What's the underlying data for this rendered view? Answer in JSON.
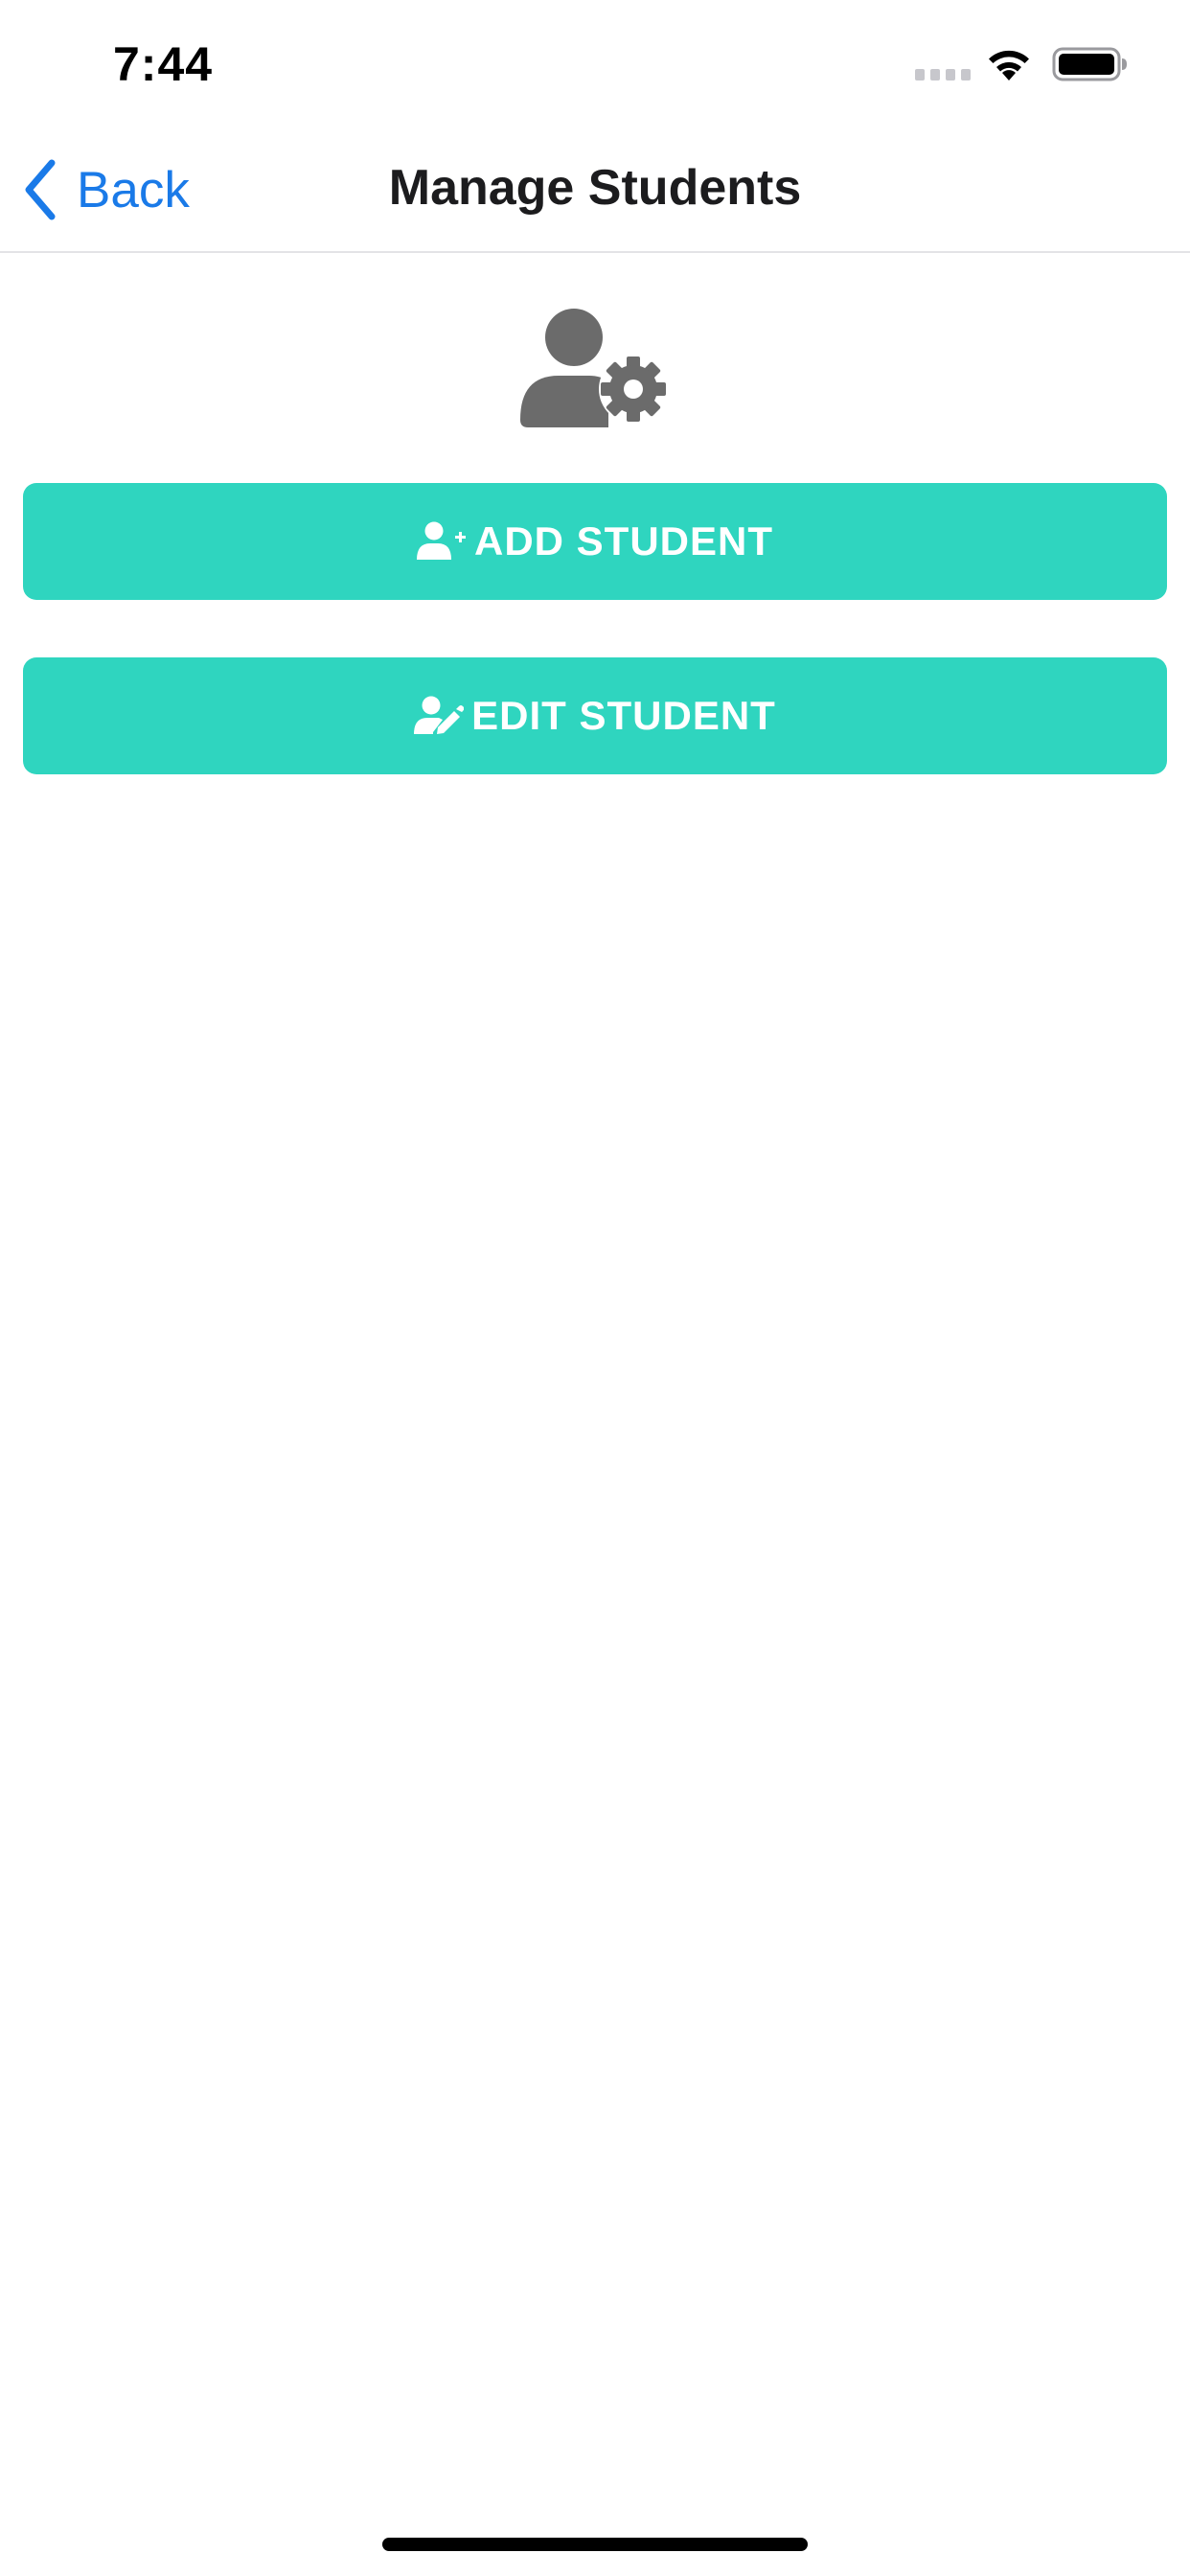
{
  "status_bar": {
    "time": "7:44",
    "icons": [
      "signal-dots-icon",
      "wifi-icon",
      "battery-icon"
    ]
  },
  "nav": {
    "back_label": "Back",
    "title": "Manage Students",
    "accent_color": "#1a7ae8"
  },
  "header": {
    "icon": "user-gear-icon",
    "icon_color": "#6b6b6b"
  },
  "actions": {
    "button_color": "#2fd5bf",
    "add": {
      "label": "ADD STUDENT",
      "icon": "user-plus-icon"
    },
    "edit": {
      "label": "EDIT STUDENT",
      "icon": "user-edit-icon"
    }
  }
}
